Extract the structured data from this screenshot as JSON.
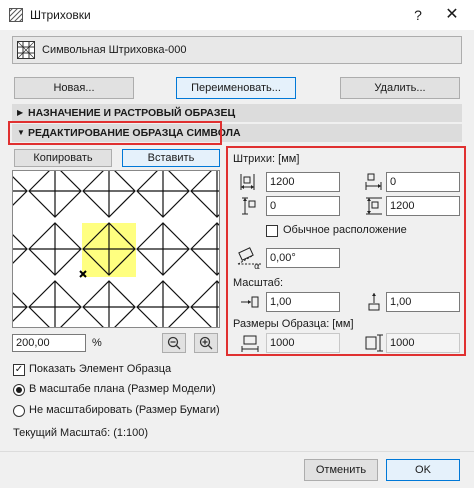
{
  "window": {
    "title": "Штриховки",
    "help": "?",
    "close": "✕"
  },
  "hatch_name": "Символьная Штриховка-000",
  "toolbar": {
    "new": "Новая...",
    "rename": "Переименовать...",
    "delete": "Удалить..."
  },
  "sections": {
    "assignment": "НАЗНАЧЕНИЕ И РАСТРОВЫЙ ОБРАЗЕЦ",
    "editing": "РЕДАКТИРОВАНИЕ ОБРАЗЦА СИМВОЛА"
  },
  "edit_buttons": {
    "copy": "Копировать",
    "paste": "Вставить"
  },
  "zoom": {
    "value": "200,00",
    "unit": "%",
    "zoom_out": "−",
    "zoom_in": "+"
  },
  "strokes": {
    "heading": "Штрихи: [мм]",
    "spacing_x": "1200",
    "offset_right": "0",
    "offset_x": "0",
    "spacing_y": "1200",
    "normal_layout_label": "Обычное расположение",
    "normal_layout_checked": false,
    "angle": "0,00°"
  },
  "scale": {
    "heading": "Масштаб:",
    "x": "1,00",
    "y": "1,00"
  },
  "sample_size": {
    "heading": "Размеры Образца: [мм]",
    "width": "1000",
    "height": "1000"
  },
  "options": {
    "show_element": "Показать Элемент Образца",
    "show_element_checked": true,
    "radio_plan": "В масштабе плана (Размер Модели)",
    "radio_paper": "Не масштабировать (Размер Бумаги)",
    "selected": "plan",
    "current_scale": "Текущий Масштаб: (1:100)"
  },
  "footer": {
    "cancel": "Отменить",
    "ok": "OK"
  },
  "colors": {
    "red_frame": "#e03030",
    "highlight": "#ffff80",
    "accent": "#0078d7"
  }
}
